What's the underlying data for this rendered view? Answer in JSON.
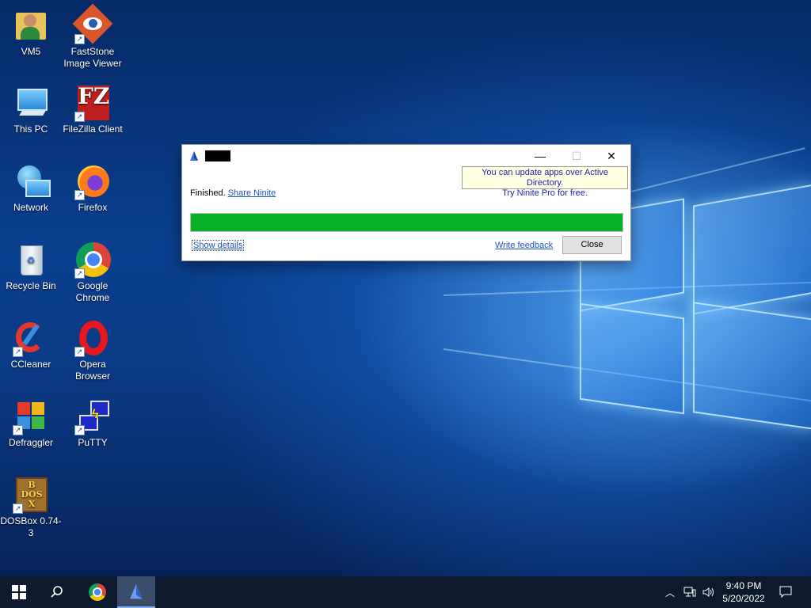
{
  "desktop": {
    "icons": [
      {
        "label": "VM5"
      },
      {
        "label": "FastStone Image Viewer"
      },
      {
        "label": "This PC"
      },
      {
        "label": "FileZilla Client"
      },
      {
        "label": "Network"
      },
      {
        "label": "Firefox"
      },
      {
        "label": "Recycle Bin"
      },
      {
        "label": "Google Chrome"
      },
      {
        "label": "CCleaner"
      },
      {
        "label": "Opera Browser"
      },
      {
        "label": "Defraggler"
      },
      {
        "label": "PuTTY"
      },
      {
        "label": "DOSBox 0.74-3"
      }
    ]
  },
  "dialog": {
    "minimize": "—",
    "maximize": "☐",
    "close_x": "✕",
    "tooltip_line1": "You can update apps over Active Directory.",
    "tooltip_line2": "Try Ninite Pro for free.",
    "status": "Finished.",
    "share_link": "Share Ninite",
    "progress": 1.0,
    "show_details": "Show details",
    "write_feedback": "Write feedback",
    "close_button": "Close"
  },
  "taskbar": {
    "time": "9:40 PM",
    "date": "5/20/2022",
    "progress_color": "#06b025"
  }
}
